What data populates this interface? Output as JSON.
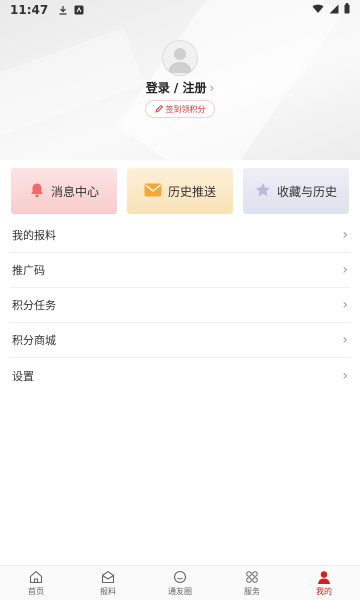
{
  "status_bar": {
    "time": "11:47"
  },
  "profile": {
    "login_text": "登录 / 注册",
    "login_chevron": "›",
    "signin_label": "签到领积分"
  },
  "cards": [
    {
      "label": "消息中心",
      "icon": "bell-icon",
      "color": "#ef6b6b"
    },
    {
      "label": "历史推送",
      "icon": "envelope-icon",
      "color": "#f2a93b"
    },
    {
      "label": "收藏与历史",
      "icon": "star-icon",
      "color": "#b9b9d8"
    }
  ],
  "menu": [
    {
      "label": "我的报料"
    },
    {
      "label": "推广码"
    },
    {
      "label": "积分任务"
    },
    {
      "label": "积分商城"
    },
    {
      "label": "设置"
    }
  ],
  "menu_chevron": "›",
  "tabbar": [
    {
      "label": "首页",
      "icon": "home-icon"
    },
    {
      "label": "报料",
      "icon": "report-icon"
    },
    {
      "label": "通友圈",
      "icon": "chat-icon"
    },
    {
      "label": "服务",
      "icon": "grid-icon"
    },
    {
      "label": "我的",
      "icon": "person-icon",
      "active": true
    }
  ],
  "colors": {
    "accent": "#d81e1e"
  }
}
